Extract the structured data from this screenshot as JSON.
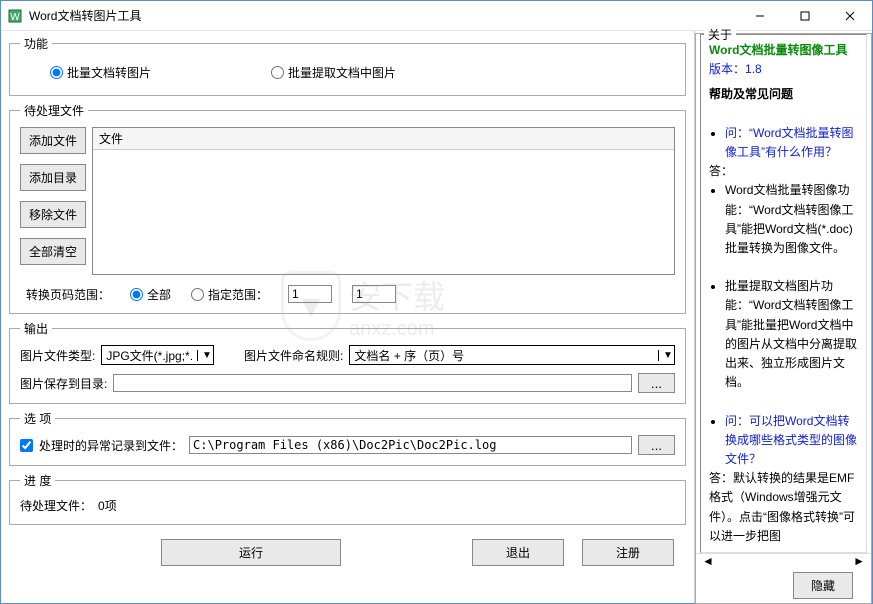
{
  "window": {
    "title": "Word文档转图片工具"
  },
  "function_group": {
    "legend": "功能",
    "opt1": "批量文档转图片",
    "opt2": "批量提取文档中图片"
  },
  "files_group": {
    "legend": "待处理文件",
    "add_file": "添加文件",
    "add_dir": "添加目录",
    "remove_file": "移除文件",
    "clear_all": "全部清空",
    "col_file": "文件",
    "page_range_label": "转换页码范围：",
    "opt_all": "全部",
    "opt_range": "指定范围：",
    "range_from": "1",
    "range_to": "1"
  },
  "output_group": {
    "legend": "输出",
    "type_label": "图片文件类型:",
    "type_value": "JPG文件(*.jpg;*.",
    "naming_label": "图片文件命名规则:",
    "naming_value": "文档名 + 序（页）号",
    "save_label": "图片保存到目录:",
    "save_value": ""
  },
  "options_group": {
    "legend": "选   项",
    "exc_label": "处理时的异常记录到文件：",
    "exc_path": "C:\\Program Files (x86)\\Doc2Pic\\Doc2Pic.log"
  },
  "progress_group": {
    "legend": "进   度",
    "pending_label": "待处理文件：",
    "pending_value": "0项"
  },
  "buttons": {
    "run": "运行",
    "exit": "退出",
    "register": "注册",
    "hide": "隐藏",
    "browse": "..."
  },
  "about": {
    "legend": "关于",
    "title": "Word文档批量转图像工具",
    "version_label": "版本：",
    "version": "1.8",
    "faq_title": "帮助及常见问题",
    "q1": "问：“Word文档批量转图像工具”有什么作用？",
    "a1_label": "答：",
    "a1_b1": "Word文档批量转图像功能：“Word文档转图像工具”能把Word文档(*.doc)批量转换为图像文件。",
    "a1_b2": "批量提取文档图片功能：“Word文档转图像工具”能批量把Word文档中的图片从文档中分离提取出来、独立形成图片文档。",
    "q2": "问：可以把Word文档转换成哪些格式类型的图像文件？",
    "a2": "答：默认转换的结果是EMF格式（Windows增强元文件）。点击“图像格式转换”可以进一步把图"
  },
  "watermark": {
    "text": "安下载",
    "sub": "anxz.com"
  }
}
